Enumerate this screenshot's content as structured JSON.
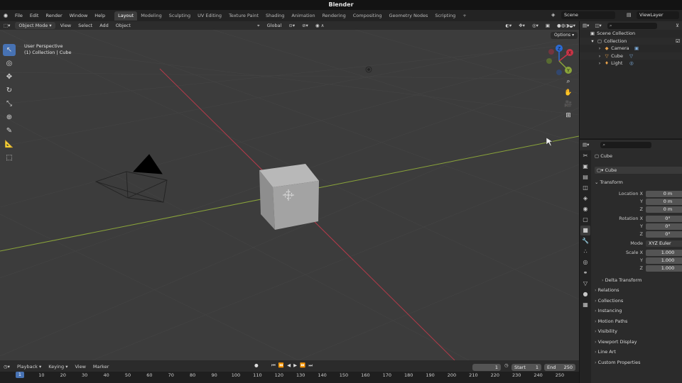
{
  "window": {
    "title": "Blender"
  },
  "topbar": {
    "menus": [
      "File",
      "Edit",
      "Render",
      "Window",
      "Help"
    ],
    "workspaces": [
      "Layout",
      "Modeling",
      "Sculpting",
      "UV Editing",
      "Texture Paint",
      "Shading",
      "Animation",
      "Rendering",
      "Compositing",
      "Geometry Nodes",
      "Scripting"
    ],
    "active_workspace": "Layout",
    "add_tab": "+",
    "scene": "Scene",
    "view_layer": "ViewLayer"
  },
  "viewport": {
    "mode": "Object Mode",
    "menus": [
      "View",
      "Select",
      "Add",
      "Object"
    ],
    "orientation": "Global",
    "options": "Options",
    "info_line1": "User Perspective",
    "info_line2": "(1) Collection | Cube",
    "gizmo": {
      "x": "X",
      "y": "Y",
      "z": "Z"
    }
  },
  "timeline": {
    "menus": [
      "Playback",
      "Keying",
      "View",
      "Marker"
    ],
    "current_frame": "1",
    "start_label": "Start",
    "start": "1",
    "end_label": "End",
    "end": "250",
    "ticks": [
      "1",
      "10",
      "20",
      "30",
      "40",
      "50",
      "60",
      "70",
      "80",
      "90",
      "100",
      "110",
      "120",
      "130",
      "140",
      "150",
      "160",
      "170",
      "180",
      "190",
      "200",
      "210",
      "220",
      "230",
      "240",
      "250"
    ]
  },
  "outliner": {
    "scene_collection": "Scene Collection",
    "collection": "Collection",
    "items": [
      "Camera",
      "Cube",
      "Light"
    ]
  },
  "properties": {
    "object_name": "Cube",
    "data_name": "Cube",
    "transform": "Transform",
    "location_label": "Location X",
    "rotation_label": "Rotation X",
    "scale_label": "Scale X",
    "y_label": "Y",
    "z_label": "Z",
    "loc": [
      "0 m",
      "0 m",
      "0 m"
    ],
    "rot": [
      "0°",
      "0°",
      "0°"
    ],
    "scale": [
      "1.000",
      "1.000",
      "1.000"
    ],
    "mode_label": "Mode",
    "mode_value": "XYZ Euler",
    "panels": [
      "Delta Transform",
      "Relations",
      "Collections",
      "Instancing",
      "Motion Paths",
      "Visibility",
      "Viewport Display",
      "Line Art",
      "Custom Properties"
    ]
  },
  "colors": {
    "accent": "#4772b3",
    "x_axis": "#b53a4a",
    "y_axis": "#8aa43a"
  }
}
